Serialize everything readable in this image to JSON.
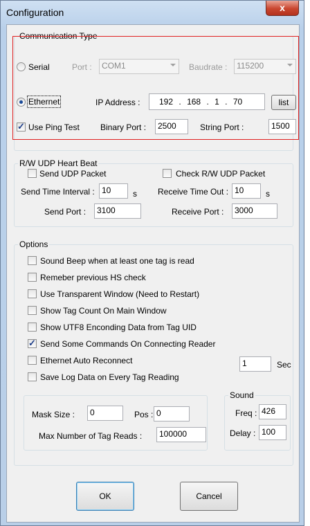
{
  "window": {
    "title": "Configuration",
    "close_label": "x"
  },
  "comm": {
    "legend": "Communication Type",
    "serial_label": "Serial",
    "port_label": "Port :",
    "port_value": "COM1",
    "baud_label": "Baudrate :",
    "baud_value": "115200",
    "ethernet_label": "Ethernet",
    "ip_label": "IP Address :",
    "ip": [
      "192",
      "168",
      "1",
      "70"
    ],
    "ip_dot": ".",
    "list_button": "list",
    "ping_label": "Use Ping Test",
    "binary_label": "Binary Port :",
    "binary_value": "2500",
    "string_label": "String Port :",
    "string_value": "1500",
    "selected": "Ethernet",
    "ping_checked": true
  },
  "udp": {
    "legend": "R/W UDP Heart Beat",
    "send_packet_label": "Send UDP Packet",
    "check_packet_label": "Check R/W UDP Packet",
    "send_interval_label": "Send Time Interval :",
    "send_interval_value": "10",
    "send_interval_unit": "s",
    "receive_timeout_label": "Receive Time Out :",
    "receive_timeout_value": "10",
    "receive_timeout_unit": "s",
    "send_port_label": "Send Port :",
    "send_port_value": "3100",
    "receive_port_label": "Receive Port :",
    "receive_port_value": "3000"
  },
  "options": {
    "legend": "Options",
    "items": [
      {
        "label": "Sound Beep when at least one tag is read",
        "checked": false
      },
      {
        "label": "Remeber previous HS check",
        "checked": false
      },
      {
        "label": "Use Transparent Window (Need to Restart)",
        "checked": false
      },
      {
        "label": "Show Tag Count On Main Window",
        "checked": false
      },
      {
        "label": "Show UTF8 Enconding Data from Tag UID",
        "checked": false
      },
      {
        "label": "Send Some Commands On Connecting Reader",
        "checked": true
      },
      {
        "label": "Ethernet Auto Reconnect",
        "checked": false
      },
      {
        "label": "Save Log Data on Every Tag Reading",
        "checked": false
      }
    ],
    "reconnect_value": "1",
    "reconnect_unit": "Sec",
    "mask_size_label": "Mask Size :",
    "mask_size_value": "0",
    "pos_label": "Pos :",
    "pos_value": "0",
    "max_reads_label": "Max Number of Tag Reads :",
    "max_reads_value": "100000",
    "sound": {
      "legend": "Sound",
      "freq_label": "Freq :",
      "freq_value": "426",
      "delay_label": "Delay :",
      "delay_value": "100"
    }
  },
  "buttons": {
    "ok": "OK",
    "cancel": "Cancel"
  },
  "colors": {
    "highlight_box": "#e02020",
    "dialog_face": "#f0f0f0",
    "title_gradient": "#cfe0f2"
  }
}
